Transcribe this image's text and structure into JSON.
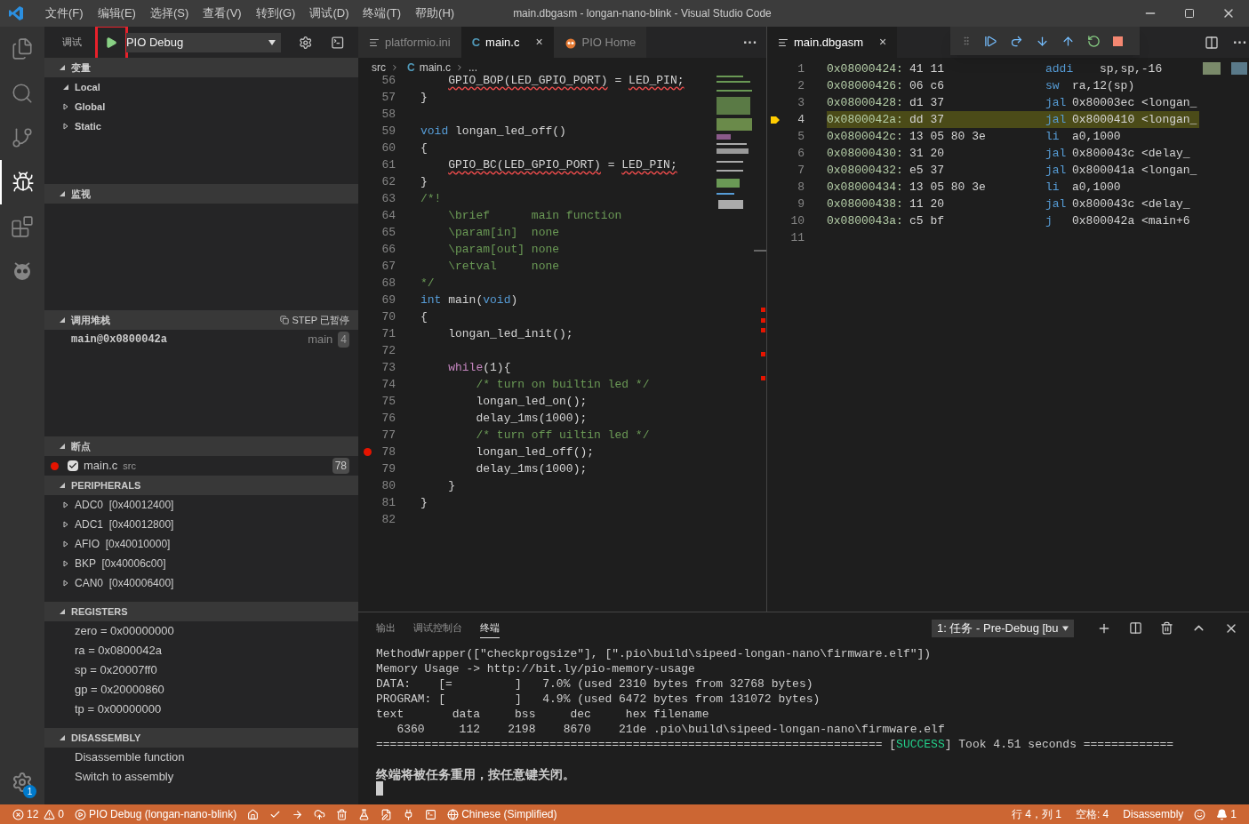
{
  "window": {
    "title": "main.dbgasm - longan-nano-blink - Visual Studio Code"
  },
  "menu": [
    "文件(F)",
    "编辑(E)",
    "选择(S)",
    "查看(V)",
    "转到(G)",
    "调试(D)",
    "终端(T)",
    "帮助(H)"
  ],
  "activity_bar": [
    {
      "kind": "files",
      "selected": false
    },
    {
      "kind": "search",
      "selected": false
    },
    {
      "kind": "scm",
      "selected": false
    },
    {
      "kind": "debug",
      "selected": true
    },
    {
      "kind": "extensions",
      "selected": false
    },
    {
      "kind": "platformio",
      "selected": false
    }
  ],
  "settings_badge": "1",
  "debug_toolbar": {
    "label": "调试",
    "configuration": "PIO Debug"
  },
  "sidebar": [
    {
      "kind": "tree",
      "title": "变量",
      "expanded": true,
      "items": [
        {
          "label": "Local",
          "expanded": true
        },
        {
          "label": "Global",
          "expanded": false
        },
        {
          "label": "Static",
          "expanded": false
        }
      ]
    },
    {
      "kind": "empty",
      "title": "监视",
      "expanded": true
    },
    {
      "kind": "callstack",
      "title": "调用堆栈",
      "expanded": true,
      "status": "STEP 已暂停",
      "frames": [
        {
          "name": "main@0x0800042a",
          "file": "main",
          "line": "4"
        }
      ]
    },
    {
      "kind": "breakpoints",
      "title": "断点",
      "expanded": true,
      "items": [
        {
          "file": "main.c",
          "folder": "src",
          "line": "78",
          "checked": true
        }
      ]
    },
    {
      "kind": "tree",
      "title": "PERIPHERALS",
      "expanded": true,
      "items": [
        {
          "label": "ADC0  [0x40012400]",
          "expanded": false
        },
        {
          "label": "ADC1  [0x40012800]",
          "expanded": false
        },
        {
          "label": "AFIO  [0x40010000]",
          "expanded": false
        },
        {
          "label": "BKP  [0x40006c00]",
          "expanded": false
        },
        {
          "label": "CAN0  [0x40006400]",
          "expanded": false
        }
      ]
    },
    {
      "kind": "list",
      "title": "REGISTERS",
      "expanded": true,
      "items": [
        "zero = 0x00000000",
        "ra = 0x0800042a",
        "sp = 0x20007ff0",
        "gp = 0x20000860",
        "tp = 0x00000000"
      ]
    },
    {
      "kind": "list",
      "title": "DISASSEMBLY",
      "expanded": true,
      "items": [
        "Disassemble function",
        "Switch to assembly"
      ]
    }
  ],
  "editor_left": {
    "tabs": [
      {
        "kind": "ini",
        "label": "platformio.ini",
        "selected": false
      },
      {
        "kind": "c",
        "icon_letter": "C",
        "label": "main.c",
        "close": "×",
        "selected": true
      },
      {
        "kind": "pio",
        "label": "PIO Home",
        "selected": false
      }
    ],
    "more": "···",
    "breadcrumb": {
      "folder": "src",
      "icon_letter": "C",
      "file": "main.c",
      "tail": "..."
    },
    "lines": [
      {
        "number": "56",
        "tokens": [
          {
            "text": "    GPIO_BOP(LED_GPIO_PORT)",
            "kind": "error"
          },
          {
            "text": " = ",
            "kind": "plain"
          },
          {
            "text": "LED_PIN;",
            "kind": "error"
          }
        ]
      },
      {
        "number": "57",
        "tokens": [
          {
            "text": "}",
            "kind": "plain"
          }
        ]
      },
      {
        "number": "58"
      },
      {
        "number": "59",
        "tokens": [
          {
            "text": "void",
            "kind": "keyword"
          },
          {
            "text": " longan_led_off()",
            "kind": "plain"
          }
        ]
      },
      {
        "number": "60",
        "tokens": [
          {
            "text": "{",
            "kind": "plain"
          }
        ]
      },
      {
        "number": "61",
        "tokens": [
          {
            "text": "    GPIO_BC(LED_GPIO_PORT)",
            "kind": "error"
          },
          {
            "text": " = ",
            "kind": "plain"
          },
          {
            "text": "LED_PIN;",
            "kind": "error"
          }
        ]
      },
      {
        "number": "62",
        "tokens": [
          {
            "text": "}",
            "kind": "plain"
          }
        ]
      },
      {
        "number": "63",
        "tokens": [
          {
            "text": "/*!",
            "kind": "comment"
          }
        ]
      },
      {
        "number": "64",
        "tokens": [
          {
            "text": "    \\brief      main function",
            "kind": "comment"
          }
        ]
      },
      {
        "number": "65",
        "tokens": [
          {
            "text": "    \\param[in]  none",
            "kind": "comment"
          }
        ]
      },
      {
        "number": "66",
        "tokens": [
          {
            "text": "    \\param[out] none",
            "kind": "comment"
          }
        ]
      },
      {
        "number": "67",
        "tokens": [
          {
            "text": "    \\retval     none",
            "kind": "comment"
          }
        ]
      },
      {
        "number": "68",
        "tokens": [
          {
            "text": "*/",
            "kind": "comment"
          }
        ]
      },
      {
        "number": "69",
        "tokens": [
          {
            "text": "int",
            "kind": "keyword"
          },
          {
            "text": " main(",
            "kind": "plain"
          },
          {
            "text": "void",
            "kind": "keyword"
          },
          {
            "text": ")",
            "kind": "plain"
          }
        ]
      },
      {
        "number": "70",
        "tokens": [
          {
            "text": "{",
            "kind": "plain"
          }
        ]
      },
      {
        "number": "71",
        "tokens": [
          {
            "text": "    longan_led_init();",
            "kind": "plain"
          }
        ]
      },
      {
        "number": "72"
      },
      {
        "number": "73",
        "tokens": [
          {
            "text": "    while",
            "kind": "control"
          },
          {
            "text": "(1){",
            "kind": "plain"
          }
        ]
      },
      {
        "number": "74",
        "tokens": [
          {
            "text": "        /* turn on builtin led */",
            "kind": "comment"
          }
        ]
      },
      {
        "number": "75",
        "tokens": [
          {
            "text": "        longan_led_on();",
            "kind": "plain"
          }
        ]
      },
      {
        "number": "76",
        "tokens": [
          {
            "text": "        delay_1ms(1000);",
            "kind": "plain"
          }
        ]
      },
      {
        "number": "77",
        "tokens": [
          {
            "text": "        /* turn off uiltin led */",
            "kind": "comment"
          }
        ]
      },
      {
        "number": "78",
        "breakpoint": true,
        "tokens": [
          {
            "text": "        longan_led_off();",
            "kind": "plain"
          }
        ]
      },
      {
        "number": "79",
        "tokens": [
          {
            "text": "        delay_1ms(1000);",
            "kind": "plain"
          }
        ]
      },
      {
        "number": "80",
        "tokens": [
          {
            "text": "    }",
            "kind": "plain"
          }
        ]
      },
      {
        "number": "81",
        "tokens": [
          {
            "text": "}",
            "kind": "plain"
          }
        ]
      },
      {
        "number": "82"
      }
    ]
  },
  "editor_right": {
    "tabs": [
      {
        "label": "main.dbgasm",
        "close": "×",
        "selected": true
      }
    ],
    "more": "···",
    "lines": [
      {
        "number": "1",
        "address": "0x08000424:",
        "bytes": "41 11",
        "op": "addi",
        "args": "sp,sp,-16",
        "current": false
      },
      {
        "number": "2",
        "address": "0x08000426:",
        "bytes": "06 c6",
        "op": "sw",
        "args": "ra,12(sp)",
        "current": false
      },
      {
        "number": "3",
        "address": "0x08000428:",
        "bytes": "d1 37",
        "op": "jal",
        "args": "0x80003ec <longan_",
        "current": false
      },
      {
        "number": "4",
        "address": "0x0800042a:",
        "bytes": "dd 37",
        "op": "jal",
        "args": "0x8000410 <longan_",
        "current": true
      },
      {
        "number": "5",
        "address": "0x0800042c:",
        "bytes": "13 05 80 3e",
        "op": "li",
        "args": "a0,1000",
        "current": false
      },
      {
        "number": "6",
        "address": "0x08000430:",
        "bytes": "31 20",
        "op": "jal",
        "args": "0x800043c <delay_",
        "current": false
      },
      {
        "number": "7",
        "address": "0x08000432:",
        "bytes": "e5 37",
        "op": "jal",
        "args": "0x800041a <longan_",
        "current": false
      },
      {
        "number": "8",
        "address": "0x08000434:",
        "bytes": "13 05 80 3e",
        "op": "li",
        "args": "a0,1000",
        "current": false
      },
      {
        "number": "9",
        "address": "0x08000438:",
        "bytes": "11 20",
        "op": "jal",
        "args": "0x800043c <delay_",
        "current": false
      },
      {
        "number": "10",
        "address": "0x0800043a:",
        "bytes": "c5 bf",
        "op": "j",
        "args": "0x800042a <main+6",
        "current": false
      },
      {
        "number": "11",
        "current": false
      }
    ]
  },
  "panel": {
    "tabs": [
      {
        "label": "输出",
        "selected": false
      },
      {
        "label": "调试控制台",
        "selected": false
      },
      {
        "label": "终端",
        "selected": true
      }
    ],
    "terminal_select": "1: 任务 - Pre-Debug [bu",
    "lines": [
      {
        "kind": "output",
        "tokens": [
          {
            "text": "MethodWrapper([\"checkprogsize\"], [\".pio\\build\\sipeed-longan-nano\\firmware.elf\"])",
            "kind": "plain"
          }
        ]
      },
      {
        "kind": "output",
        "tokens": [
          {
            "text": "Memory Usage -> http://bit.ly/pio-memory-usage",
            "kind": "plain"
          }
        ]
      },
      {
        "kind": "output",
        "tokens": [
          {
            "text": "DATA:    [=         ]   7.0% (used 2310 bytes from 32768 bytes)",
            "kind": "plain"
          }
        ]
      },
      {
        "kind": "output",
        "tokens": [
          {
            "text": "PROGRAM: [          ]   4.9% (used 6472 bytes from 131072 bytes)",
            "kind": "plain"
          }
        ]
      },
      {
        "kind": "output",
        "tokens": [
          {
            "text": "text       data     bss     dec     hex filename",
            "kind": "plain"
          }
        ]
      },
      {
        "kind": "output",
        "tokens": [
          {
            "text": "   6360     112    2198    8670    21de .pio\\build\\sipeed-longan-nano\\firmware.elf",
            "kind": "plain"
          }
        ]
      },
      {
        "kind": "output",
        "tokens": [
          {
            "text": "========================================================================= [",
            "kind": "plain"
          },
          {
            "text": "SUCCESS",
            "kind": "success"
          },
          {
            "text": "] Took 4.51 seconds =============",
            "kind": "plain"
          }
        ]
      },
      {
        "kind": "notice",
        "tokens": [
          {
            "text": "终端将被任务重用，按任意键关闭。",
            "kind": "bold"
          }
        ]
      }
    ]
  },
  "status_bar": {
    "errors": "12",
    "warnings": "0",
    "debug": "PIO Debug (longan-nano-blink)",
    "language": "Chinese (Simplified)",
    "position": "行 4，列 1",
    "indent": "空格: 4",
    "mode": "Disassembly",
    "notifications": "1"
  }
}
